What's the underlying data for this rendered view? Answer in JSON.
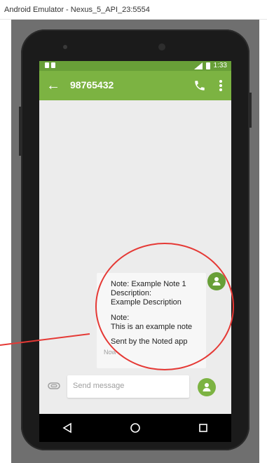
{
  "window": {
    "title": "Android Emulator - Nexus_5_API_23:5554"
  },
  "statusbar": {
    "time": "1:33"
  },
  "appbar": {
    "contact": "98765432"
  },
  "message": {
    "lines": [
      "Note: Example Note 1",
      "Description:",
      "Example Description",
      "Note:",
      "This is an example note",
      "Sent by the Noted app"
    ],
    "timestamp": "Now"
  },
  "compose": {
    "placeholder": "Send message"
  },
  "colors": {
    "appbar": "#7cb342",
    "statusbar": "#689f38",
    "annotation": "#e53935"
  }
}
